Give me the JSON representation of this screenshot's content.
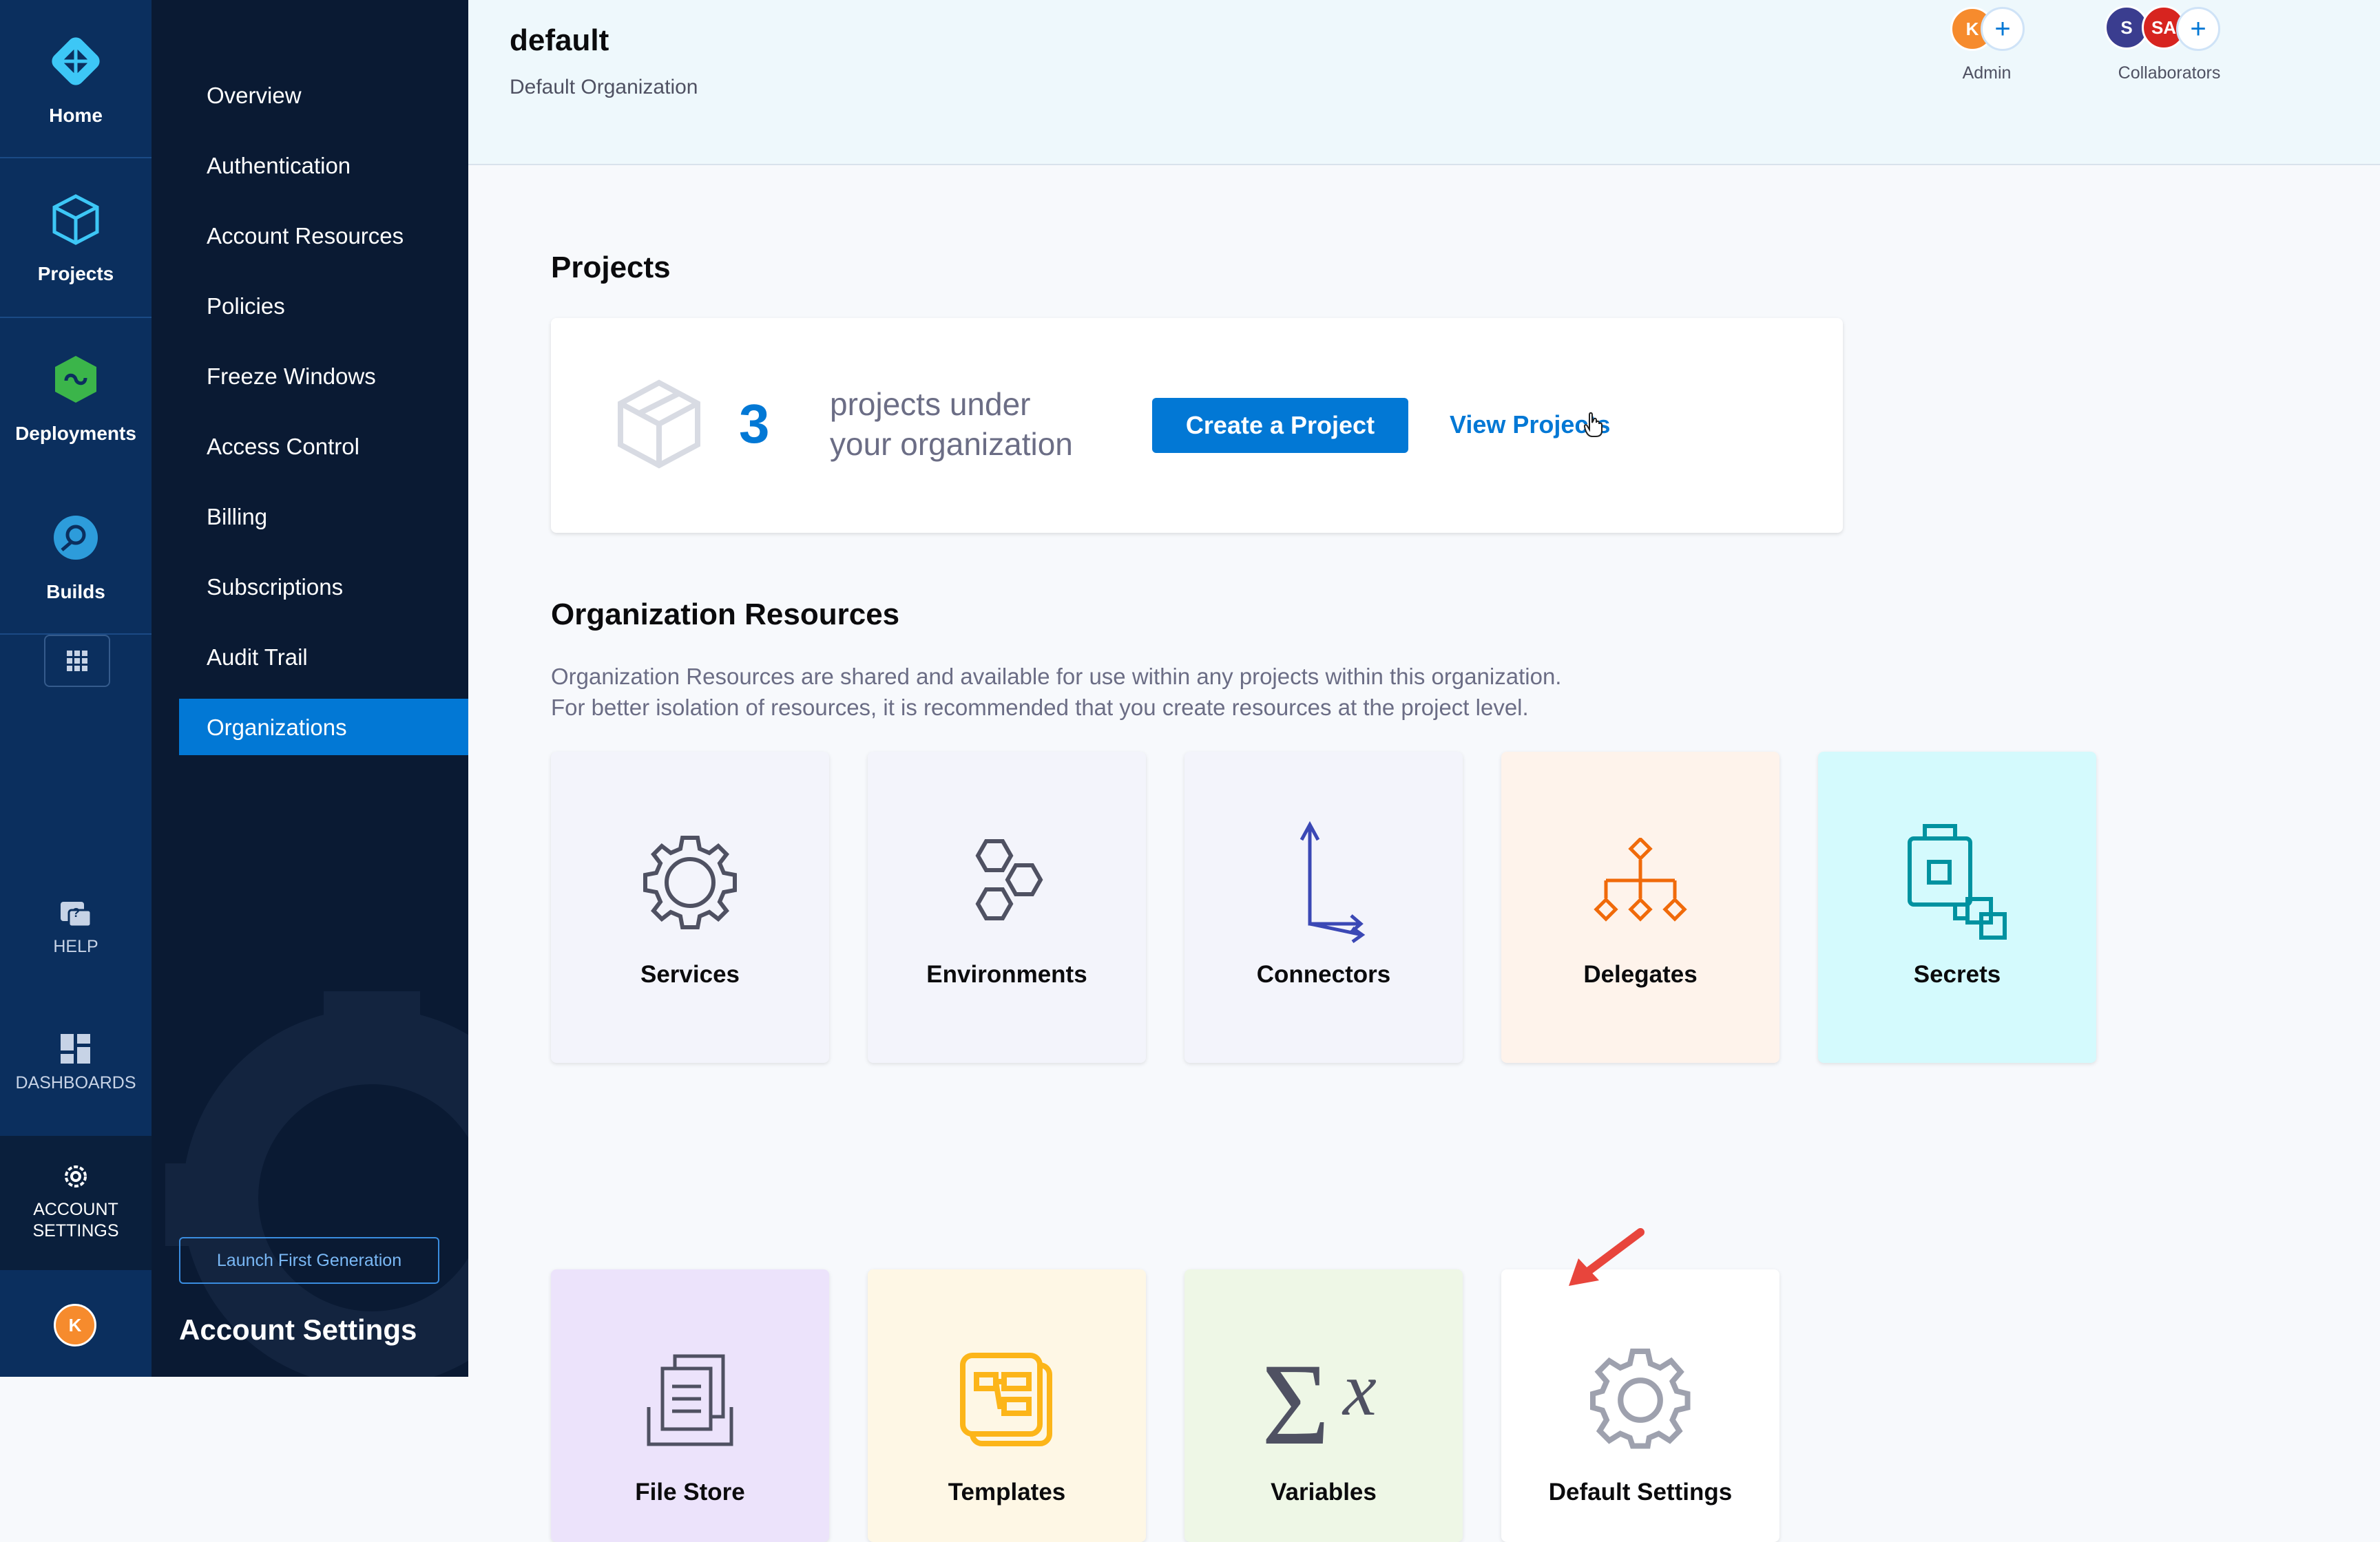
{
  "rail": {
    "items": [
      {
        "label": "Home"
      },
      {
        "label": "Projects"
      },
      {
        "label": "Deployments"
      },
      {
        "label": "Builds"
      }
    ],
    "help_label": "HELP",
    "dashboards_label": "DASHBOARDS",
    "account_settings_label": "ACCOUNT\nSETTINGS",
    "user_initial": "K"
  },
  "sidebar": {
    "items": [
      {
        "label": "Overview"
      },
      {
        "label": "Authentication"
      },
      {
        "label": "Account Resources"
      },
      {
        "label": "Policies"
      },
      {
        "label": "Freeze Windows"
      },
      {
        "label": "Access Control"
      },
      {
        "label": "Billing"
      },
      {
        "label": "Subscriptions"
      },
      {
        "label": "Audit Trail"
      },
      {
        "label": "Organizations"
      }
    ],
    "active": "Organizations",
    "launch_button": "Launch First Generation",
    "title": "Account Settings"
  },
  "header": {
    "org_name": "default",
    "org_subtitle": "Default Organization",
    "admin": {
      "initials": [
        "K"
      ],
      "label": "Admin"
    },
    "collaborators": {
      "initials": [
        "S",
        "SA"
      ],
      "label": "Collaborators"
    },
    "plus": "+"
  },
  "projects": {
    "heading": "Projects",
    "count": "3",
    "text_line1": "projects under",
    "text_line2": "your organization",
    "create_button": "Create a Project",
    "view_link": "View Projects"
  },
  "org_resources": {
    "heading": "Organization Resources",
    "desc_line1": "Organization Resources are shared and available for use within any projects within this organization.",
    "desc_line2": "For better isolation of resources, it is recommended that you create resources at the project level.",
    "tiles": [
      {
        "label": "Services",
        "icon": "gear-icon"
      },
      {
        "label": "Environments",
        "icon": "hexagons-icon"
      },
      {
        "label": "Connectors",
        "icon": "connector-arrows-icon"
      },
      {
        "label": "Delegates",
        "icon": "delegate-tree-icon"
      },
      {
        "label": "Secrets",
        "icon": "secrets-lock-icon"
      },
      {
        "label": "File Store",
        "icon": "file-store-icon"
      },
      {
        "label": "Templates",
        "icon": "templates-icon"
      },
      {
        "label": "Variables",
        "icon": "sigma-x-icon"
      },
      {
        "label": "Default Settings",
        "icon": "settings-gear-icon"
      }
    ]
  },
  "colors": {
    "accent": "#0278d5",
    "rail_bg": "#0b2f5e",
    "sidebar_bg": "#0a1a33",
    "header_bg": "#eef8fc",
    "annotation_arrow": "#e8453c"
  }
}
